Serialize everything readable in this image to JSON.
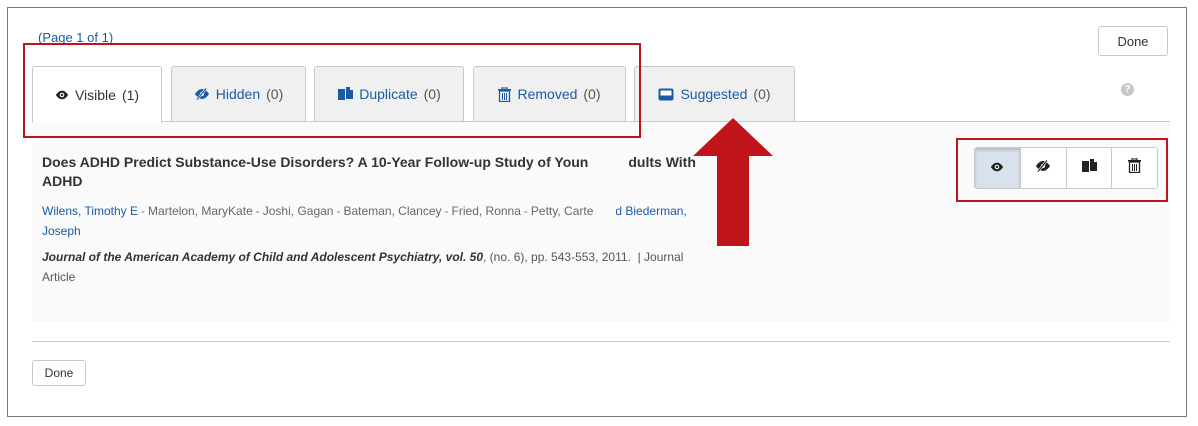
{
  "pager": {
    "text": "(Page 1 of 1)"
  },
  "buttons": {
    "done_top": "Done",
    "done_bottom": "Done"
  },
  "help": {
    "glyph": "?"
  },
  "tabs": [
    {
      "label": "Visible",
      "count": "(1)",
      "icon": "eye-icon"
    },
    {
      "label": "Hidden",
      "count": "(0)",
      "icon": "eye-slash-icon"
    },
    {
      "label": "Duplicate",
      "count": "(0)",
      "icon": "copy-icon"
    },
    {
      "label": "Removed",
      "count": "(0)",
      "icon": "trash-icon"
    },
    {
      "label": "Suggested",
      "count": "(0)",
      "icon": "inbox-icon"
    }
  ],
  "article": {
    "title_visible_part1": "Does ADHD Predict Substance-Use Disorders? A 10-Year Follow-up Study of Youn",
    "title_visible_part2": "dults With",
    "title_line2": "ADHD",
    "authors": [
      {
        "name": "Wilens, Timothy E",
        "linked": true
      },
      {
        "name": "Martelon, MaryKate",
        "linked": false
      },
      {
        "name": "Joshi, Gagan",
        "linked": false
      },
      {
        "name": "Bateman, Clancey",
        "linked": false
      },
      {
        "name": "Fried, Ronna",
        "linked": false
      },
      {
        "name": "Petty, Carte",
        "linked": false
      }
    ],
    "authors_tail": "d Biederman,",
    "authors_line2": "Joseph",
    "journal": "Journal of the American Academy of Child and Adolescent Psychiatry, vol. 50",
    "citation_rest": ", (no. 6), pp. 543-553, 2011.",
    "type_sep": "|",
    "type_part1": "Journal",
    "type_part2": "Article"
  },
  "actions": [
    {
      "name": "show",
      "icon": "eye-icon",
      "active": true
    },
    {
      "name": "hide",
      "icon": "eye-slash-icon",
      "active": false
    },
    {
      "name": "duplicate",
      "icon": "copy-icon",
      "active": false
    },
    {
      "name": "remove",
      "icon": "trash-icon",
      "active": false
    }
  ],
  "colors": {
    "link": "#1a5ba6",
    "annotation": "#c0141b",
    "active_tab_bg": "#ffffff",
    "tab_bg": "#f0f0f0"
  }
}
